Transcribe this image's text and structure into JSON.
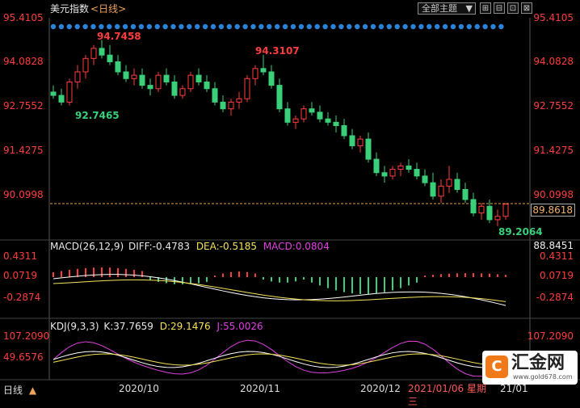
{
  "header": {
    "symbol": "美元指数",
    "period_tag": "<日线>",
    "theme_label": "全部主题",
    "theme_arrow": "▼",
    "buttons": [
      {
        "name": "toggle-grid-icon",
        "glyph": "⊞"
      },
      {
        "name": "toggle-volume-icon",
        "glyph": "⊟"
      },
      {
        "name": "layout-icon",
        "glyph": "⊡"
      },
      {
        "name": "close-panel-icon",
        "glyph": "⊠"
      }
    ]
  },
  "price_axis": {
    "labels": [
      "95.4105",
      "94.0828",
      "92.7552",
      "91.4275",
      "90.0998"
    ],
    "high_marker": "94.7458",
    "high2_marker": "94.3107",
    "low_marker": "92.7465",
    "low2_marker": "89.2064",
    "current_price": "89.8618"
  },
  "macd": {
    "title": "MACD(26,12,9)",
    "diff": "DIFF:-0.4783",
    "dea": "DEA:-0.5185",
    "macd": "MACD:0.0804",
    "axis_top": "88.8451",
    "axis": [
      "0.4311",
      "0.0719",
      "-0.2874"
    ]
  },
  "kdj": {
    "title": "KDJ(9,3,3)",
    "k": "K:37.7659",
    "d": "D:29.1476",
    "j": "J:55.0026",
    "axis": [
      "107.2090",
      "49.6576"
    ]
  },
  "footer": {
    "period": "日线",
    "period_arrow": "▲",
    "dates": [
      "2020/10",
      "2020/11",
      "2020/12"
    ],
    "cursor_date": "2021/01/06 星期三",
    "tail_date": "21/01"
  },
  "brand": {
    "name": "汇金网",
    "url": "www.gold678.com",
    "logo_glyph": "C"
  },
  "colors": {
    "up": "#ff3d3d",
    "down": "#3ad07a",
    "dea_line": "#f5e15a",
    "macd_text": "#e040e0",
    "dots": "#2a83d6"
  },
  "chart_data": {
    "type": "candlestick",
    "ylim": [
      88.8451,
      95.4105
    ],
    "ohlc": [
      [
        93.2,
        93.4,
        93.0,
        93.1
      ],
      [
        93.1,
        93.3,
        92.8,
        92.9
      ],
      [
        92.9,
        93.6,
        92.8,
        93.5
      ],
      [
        93.5,
        94.0,
        93.3,
        93.8
      ],
      [
        93.8,
        94.3,
        93.6,
        94.2
      ],
      [
        94.2,
        94.6,
        94.0,
        94.5
      ],
      [
        94.5,
        94.75,
        94.2,
        94.3
      ],
      [
        94.3,
        94.6,
        94.0,
        94.1
      ],
      [
        94.1,
        94.3,
        93.7,
        93.8
      ],
      [
        93.8,
        94.0,
        93.5,
        93.6
      ],
      [
        93.6,
        93.9,
        93.4,
        93.7
      ],
      [
        93.7,
        93.9,
        93.3,
        93.4
      ],
      [
        93.4,
        93.6,
        93.1,
        93.3
      ],
      [
        93.3,
        93.8,
        93.2,
        93.7
      ],
      [
        93.7,
        93.9,
        93.4,
        93.5
      ],
      [
        93.5,
        93.7,
        93.0,
        93.1
      ],
      [
        93.1,
        93.4,
        93.0,
        93.3
      ],
      [
        93.3,
        93.8,
        93.2,
        93.7
      ],
      [
        93.7,
        93.9,
        93.4,
        93.5
      ],
      [
        93.5,
        93.7,
        93.2,
        93.3
      ],
      [
        93.3,
        93.5,
        92.8,
        92.9
      ],
      [
        92.9,
        93.1,
        92.6,
        92.7
      ],
      [
        92.7,
        93.0,
        92.5,
        92.9
      ],
      [
        92.9,
        93.2,
        92.7,
        93.0
      ],
      [
        93.0,
        93.7,
        92.9,
        93.6
      ],
      [
        93.6,
        94.0,
        93.4,
        93.9
      ],
      [
        93.9,
        94.31,
        93.7,
        93.8
      ],
      [
        93.8,
        94.0,
        93.3,
        93.4
      ],
      [
        93.4,
        93.6,
        92.6,
        92.7
      ],
      [
        92.7,
        92.9,
        92.2,
        92.3
      ],
      [
        92.3,
        92.5,
        92.1,
        92.4
      ],
      [
        92.4,
        92.8,
        92.3,
        92.7
      ],
      [
        92.7,
        92.9,
        92.5,
        92.6
      ],
      [
        92.6,
        92.8,
        92.3,
        92.4
      ],
      [
        92.4,
        92.6,
        92.2,
        92.3
      ],
      [
        92.3,
        92.5,
        92.0,
        92.2
      ],
      [
        92.2,
        92.4,
        91.8,
        91.9
      ],
      [
        91.9,
        92.1,
        91.5,
        91.6
      ],
      [
        91.6,
        91.9,
        91.4,
        91.8
      ],
      [
        91.8,
        92.0,
        91.1,
        91.2
      ],
      [
        91.2,
        91.4,
        90.7,
        90.8
      ],
      [
        90.8,
        91.0,
        90.5,
        90.7
      ],
      [
        90.7,
        91.0,
        90.6,
        90.9
      ],
      [
        90.9,
        91.1,
        90.7,
        91.0
      ],
      [
        91.0,
        91.2,
        90.8,
        90.9
      ],
      [
        90.9,
        91.1,
        90.6,
        90.7
      ],
      [
        90.7,
        90.9,
        90.4,
        90.5
      ],
      [
        90.5,
        90.8,
        90.0,
        90.1
      ],
      [
        90.1,
        90.6,
        89.9,
        90.4
      ],
      [
        90.4,
        91.0,
        90.2,
        90.6
      ],
      [
        90.6,
        90.8,
        90.2,
        90.3
      ],
      [
        90.3,
        90.5,
        89.9,
        90.0
      ],
      [
        90.0,
        90.2,
        89.5,
        89.6
      ],
      [
        89.6,
        89.9,
        89.4,
        89.8
      ],
      [
        89.8,
        90.0,
        89.3,
        89.4
      ],
      [
        89.4,
        89.7,
        89.21,
        89.5
      ],
      [
        89.5,
        89.9,
        89.4,
        89.86
      ]
    ]
  }
}
